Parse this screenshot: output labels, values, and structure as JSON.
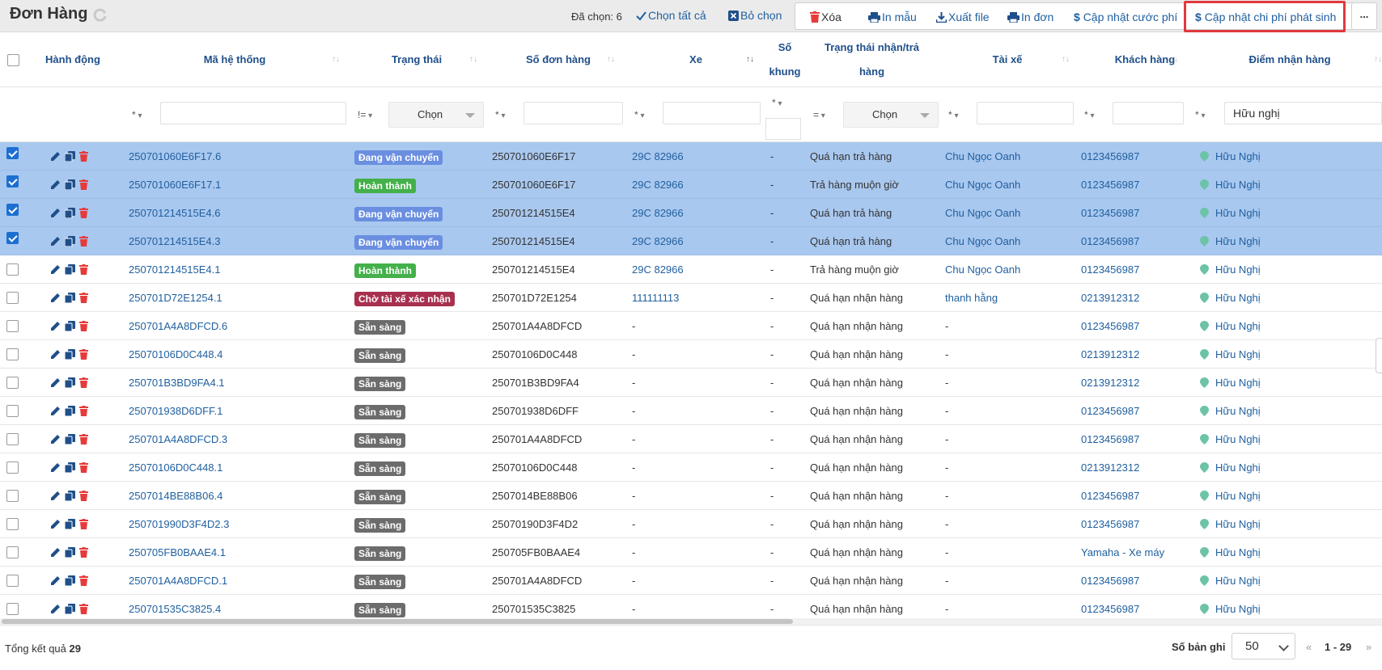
{
  "header": {
    "title": "Đơn Hàng",
    "selected_label": "Đã chọn: 6",
    "select_all": "Chọn tất cả",
    "deselect": "Bỏ chọn",
    "actions": {
      "delete": "Xóa",
      "print_template": "In mẫu",
      "export": "Xuất file",
      "print_order": "In đơn",
      "update_fee": "Cập nhật cước phí",
      "update_extra_cost": "Cập nhật chi phí phát sinh",
      "more": "..."
    }
  },
  "columns": {
    "action": "Hành động",
    "system_code": "Mã hệ thống",
    "status": "Trạng thái",
    "order_no": "Số đơn hàng",
    "vehicle": "Xe",
    "frame_no_1": "Số",
    "frame_no_2": "khung",
    "recv_status_1": "Trạng thái nhận/trả",
    "recv_status_2": "hàng",
    "driver": "Tài xế",
    "customer": "Khách hàng",
    "pickup": "Điểm nhận hàng"
  },
  "filters": {
    "op_star": "*",
    "op_neq": "!=",
    "op_eq": "=",
    "choose": "Chọn",
    "pickup_value": "Hữu nghị"
  },
  "colors": {
    "selected_row": "#a9c8ef",
    "link": "#1f5f9f",
    "status_in_transit": "#6a8ee0",
    "status_done": "#43b04a",
    "status_waiting": "#a8304e",
    "status_ready": "#6c6c6c",
    "highlight": "#e0393e"
  },
  "rows": [
    {
      "selected": true,
      "code": "250701060E6F17.6",
      "status": "Đang vận chuyển",
      "status_type": "transit",
      "order": "250701060E6F17",
      "vehicle": "29C 82966",
      "frame": "-",
      "recv": "Quá hạn trả hàng",
      "driver": "Chu Ngọc Oanh",
      "customer": "0123456987",
      "pickup": "Hữu Nghị"
    },
    {
      "selected": true,
      "code": "250701060E6F17.1",
      "status": "Hoàn thành",
      "status_type": "done",
      "order": "250701060E6F17",
      "vehicle": "29C 82966",
      "frame": "-",
      "recv": "Trả hàng muộn giờ",
      "driver": "Chu Ngọc Oanh",
      "customer": "0123456987",
      "pickup": "Hữu Nghị"
    },
    {
      "selected": true,
      "code": "250701214515E4.6",
      "status": "Đang vận chuyển",
      "status_type": "transit",
      "order": "250701214515E4",
      "vehicle": "29C 82966",
      "frame": "-",
      "recv": "Quá hạn trả hàng",
      "driver": "Chu Ngọc Oanh",
      "customer": "0123456987",
      "pickup": "Hữu Nghị"
    },
    {
      "selected": true,
      "code": "250701214515E4.3",
      "status": "Đang vận chuyển",
      "status_type": "transit",
      "order": "250701214515E4",
      "vehicle": "29C 82966",
      "frame": "-",
      "recv": "Quá hạn trả hàng",
      "driver": "Chu Ngọc Oanh",
      "customer": "0123456987",
      "pickup": "Hữu Nghị"
    },
    {
      "selected": false,
      "code": "250701214515E4.1",
      "status": "Hoàn thành",
      "status_type": "done",
      "order": "250701214515E4",
      "vehicle": "29C 82966",
      "frame": "-",
      "recv": "Trả hàng muộn giờ",
      "driver": "Chu Ngọc Oanh",
      "customer": "0123456987",
      "pickup": "Hữu Nghị"
    },
    {
      "selected": false,
      "code": "250701D72E1254.1",
      "status": "Chờ tài xế xác nhận",
      "status_type": "waiting",
      "order": "250701D72E1254",
      "vehicle": "111111113",
      "frame": "-",
      "recv": "Quá hạn nhận hàng",
      "driver": "thanh hằng",
      "customer": "0213912312",
      "pickup": "Hữu Nghị"
    },
    {
      "selected": false,
      "code": "250701A4A8DFCD.6",
      "status": "Sẵn sàng",
      "status_type": "ready",
      "order": "250701A4A8DFCD",
      "vehicle": "-",
      "frame": "-",
      "recv": "Quá hạn nhận hàng",
      "driver": "-",
      "customer": "0123456987",
      "pickup": "Hữu Nghị"
    },
    {
      "selected": false,
      "code": "25070106D0C448.4",
      "status": "Sẵn sàng",
      "status_type": "ready",
      "order": "25070106D0C448",
      "vehicle": "-",
      "frame": "-",
      "recv": "Quá hạn nhận hàng",
      "driver": "-",
      "customer": "0213912312",
      "pickup": "Hữu Nghị"
    },
    {
      "selected": false,
      "code": "250701B3BD9FA4.1",
      "status": "Sẵn sàng",
      "status_type": "ready",
      "order": "250701B3BD9FA4",
      "vehicle": "-",
      "frame": "-",
      "recv": "Quá hạn nhận hàng",
      "driver": "-",
      "customer": "0213912312",
      "pickup": "Hữu Nghị"
    },
    {
      "selected": false,
      "code": "250701938D6DFF.1",
      "status": "Sẵn sàng",
      "status_type": "ready",
      "order": "250701938D6DFF",
      "vehicle": "-",
      "frame": "-",
      "recv": "Quá hạn nhận hàng",
      "driver": "-",
      "customer": "0123456987",
      "pickup": "Hữu Nghị"
    },
    {
      "selected": false,
      "code": "250701A4A8DFCD.3",
      "status": "Sẵn sàng",
      "status_type": "ready",
      "order": "250701A4A8DFCD",
      "vehicle": "-",
      "frame": "-",
      "recv": "Quá hạn nhận hàng",
      "driver": "-",
      "customer": "0123456987",
      "pickup": "Hữu Nghị"
    },
    {
      "selected": false,
      "code": "25070106D0C448.1",
      "status": "Sẵn sàng",
      "status_type": "ready",
      "order": "25070106D0C448",
      "vehicle": "-",
      "frame": "-",
      "recv": "Quá hạn nhận hàng",
      "driver": "-",
      "customer": "0213912312",
      "pickup": "Hữu Nghị"
    },
    {
      "selected": false,
      "code": "2507014BE88B06.4",
      "status": "Sẵn sàng",
      "status_type": "ready",
      "order": "2507014BE88B06",
      "vehicle": "-",
      "frame": "-",
      "recv": "Quá hạn nhận hàng",
      "driver": "-",
      "customer": "0123456987",
      "pickup": "Hữu Nghị"
    },
    {
      "selected": false,
      "code": "250701990D3F4D2.3",
      "status": "Sẵn sàng",
      "status_type": "ready",
      "order": "25070190D3F4D2",
      "vehicle": "-",
      "frame": "-",
      "recv": "Quá hạn nhận hàng",
      "driver": "-",
      "customer": "0123456987",
      "pickup": "Hữu Nghị"
    },
    {
      "selected": false,
      "code": "250705FB0BAAE4.1",
      "status": "Sẵn sàng",
      "status_type": "ready",
      "order": "250705FB0BAAE4",
      "vehicle": "-",
      "frame": "-",
      "recv": "Quá hạn nhận hàng",
      "driver": "-",
      "customer": "Yamaha - Xe máy",
      "pickup": "Hữu Nghị"
    },
    {
      "selected": false,
      "code": "250701A4A8DFCD.1",
      "status": "Sẵn sàng",
      "status_type": "ready",
      "order": "250701A4A8DFCD",
      "vehicle": "-",
      "frame": "-",
      "recv": "Quá hạn nhận hàng",
      "driver": "-",
      "customer": "0123456987",
      "pickup": "Hữu Nghị"
    },
    {
      "selected": false,
      "code": "250701535C3825.4",
      "status": "Sẵn sàng",
      "status_type": "ready",
      "order": "250701535C3825",
      "vehicle": "-",
      "frame": "-",
      "recv": "Quá hạn nhận hàng",
      "driver": "-",
      "customer": "0123456987",
      "pickup": "Hữu Nghị"
    }
  ],
  "footer": {
    "total_label": "Tổng kết quả",
    "total_value": "29",
    "page_size_label": "Số bản ghi",
    "page_size": "50",
    "prev": "«",
    "range": "1 - 29",
    "next": "»"
  }
}
